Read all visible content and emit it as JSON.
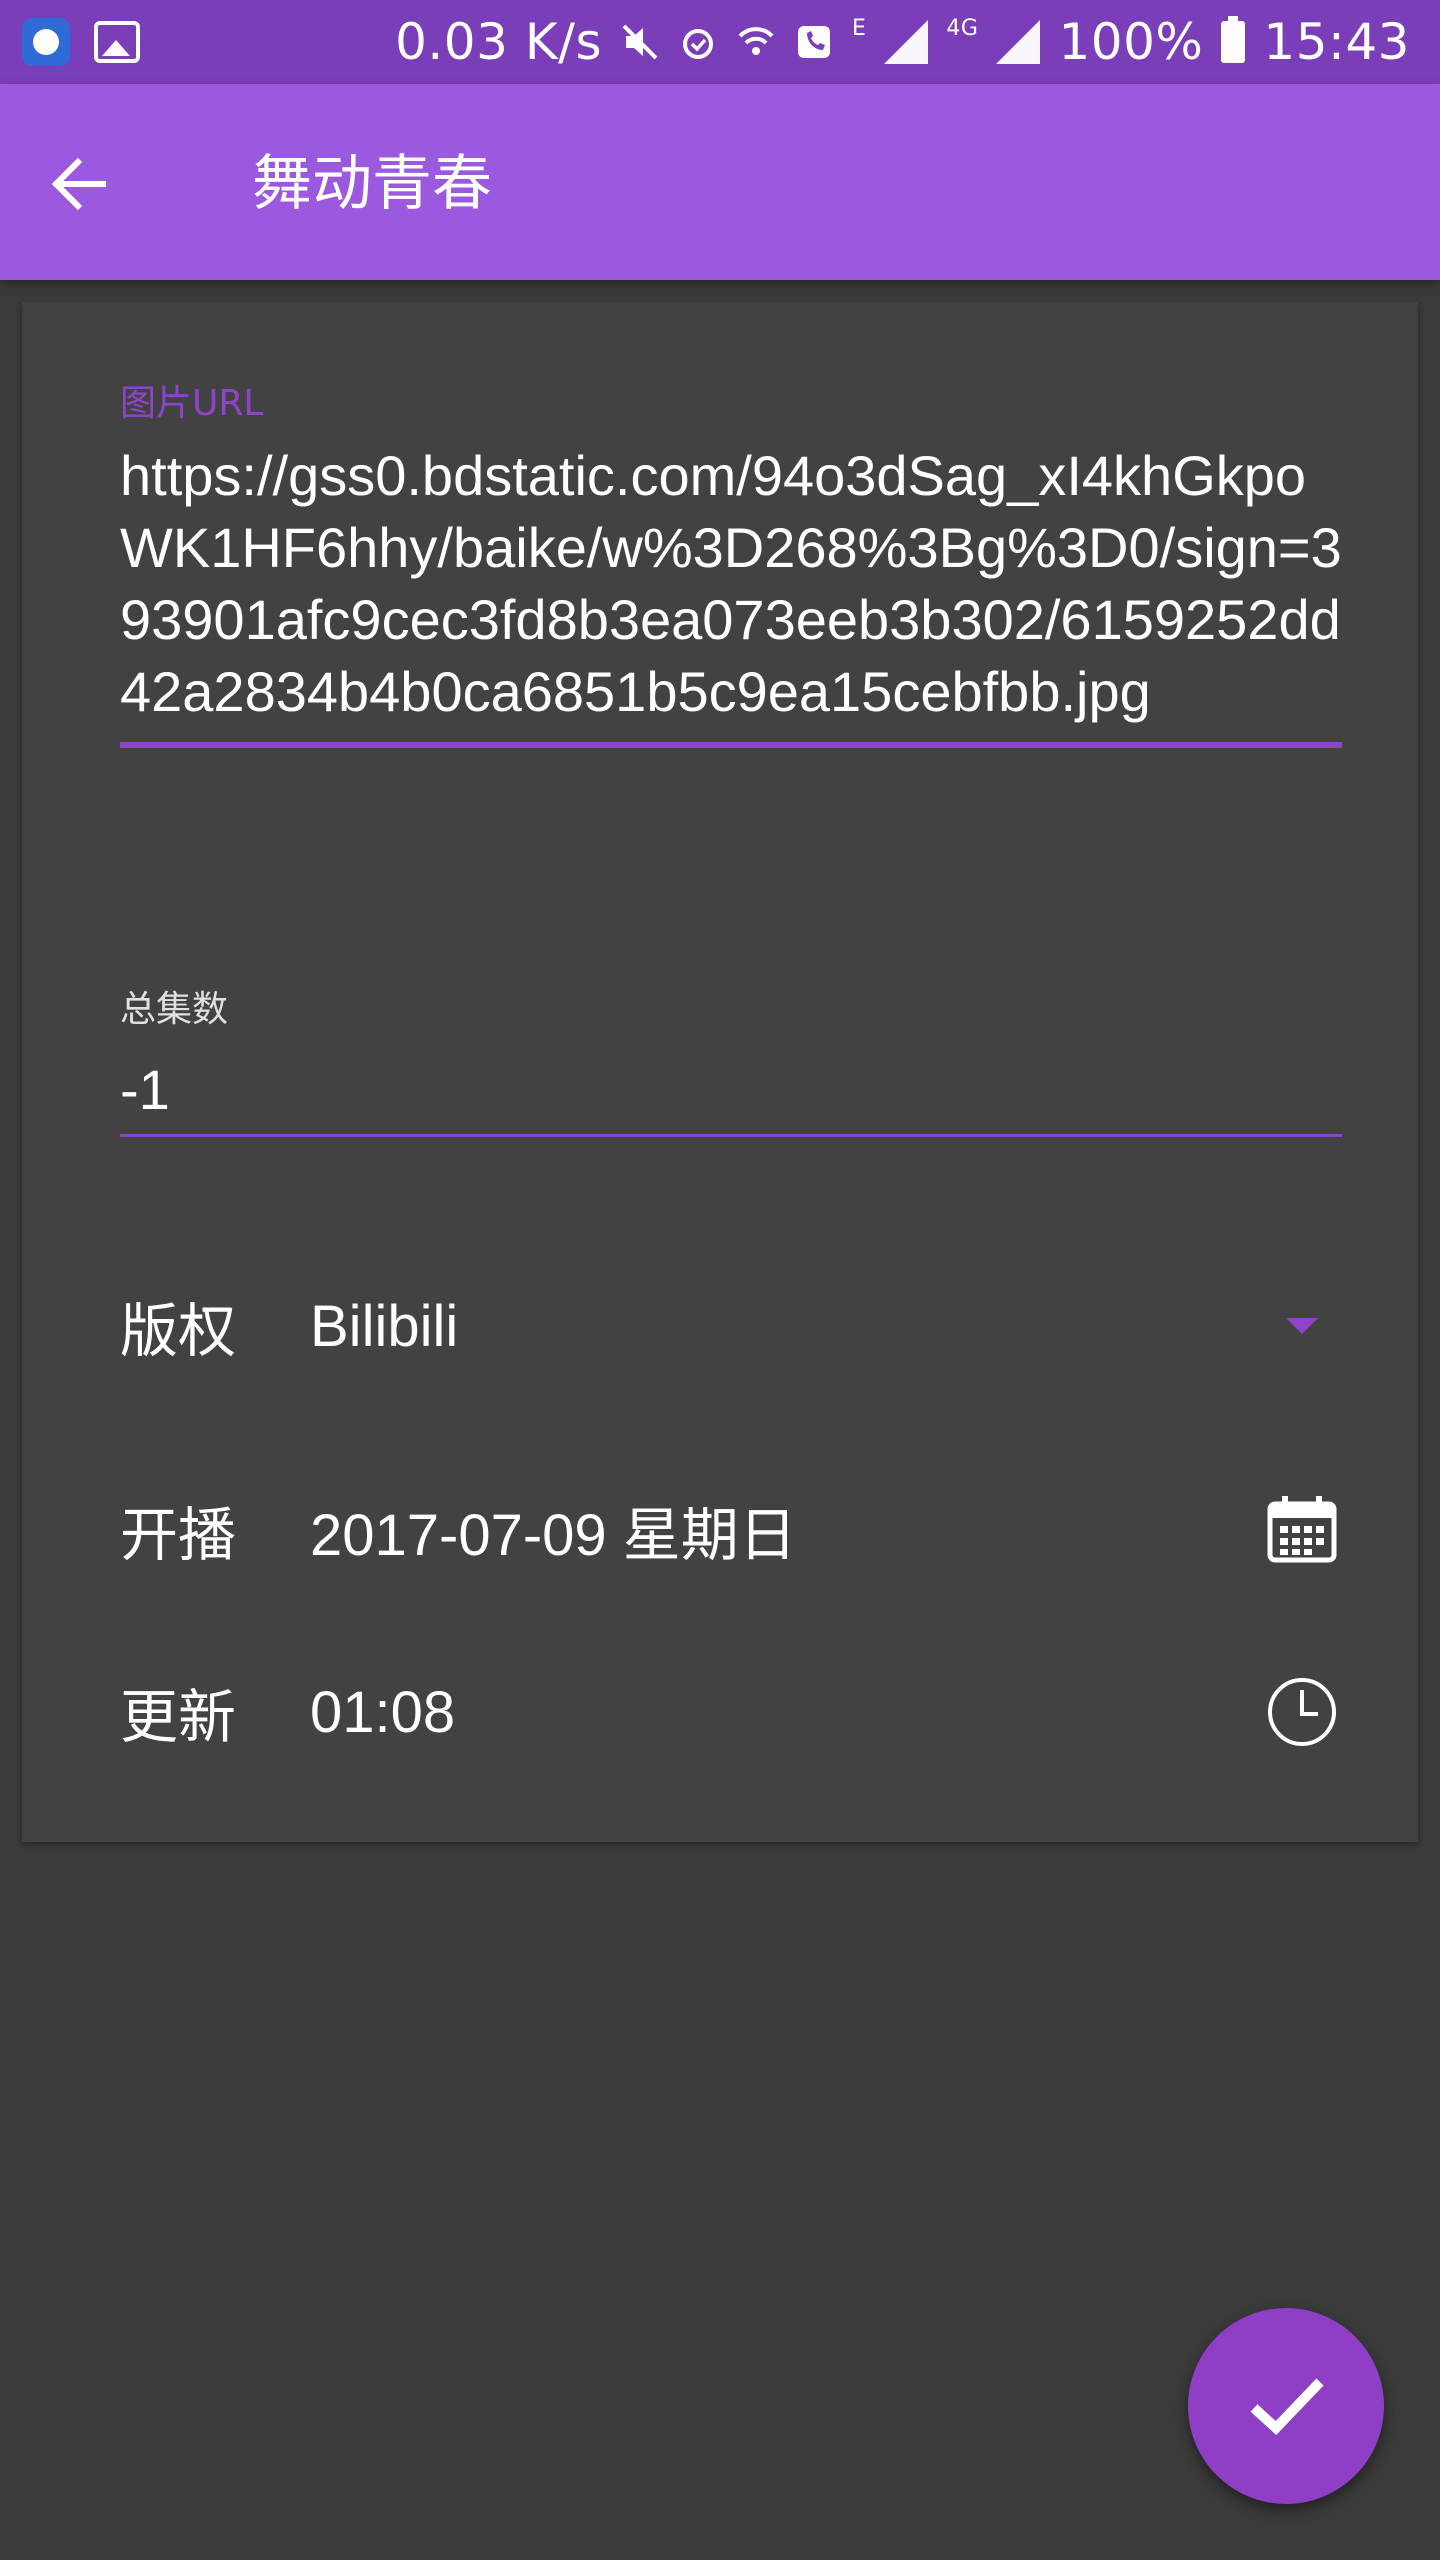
{
  "status_bar": {
    "network_speed": "0.03 K/s",
    "edge_label": "E",
    "lte_label": "4G",
    "battery": "100%",
    "time": "15:43"
  },
  "app_bar": {
    "title": "舞动青春"
  },
  "form": {
    "image_url": {
      "label": "图片URL",
      "value": "https://gss0.bdstatic.com/94o3dSag_xI4khGkpoWK1HF6hhy/baike/w%3D268%3Bg%3D0/sign=393901afc9cec3fd8b3ea073eeb3b302/6159252dd42a2834b4b0ca6851b5c9ea15cebfbb.jpg"
    },
    "total_episodes": {
      "label": "总集数",
      "value": "-1"
    },
    "copyright": {
      "label": "版权",
      "value": "Bilibili"
    },
    "start_date": {
      "label": "开播",
      "value": "2017-07-09 星期日"
    },
    "update_time": {
      "label": "更新",
      "value": "01:08"
    }
  },
  "icons": {
    "back": "arrow-back-icon",
    "dropdown": "triangle-down-icon",
    "calendar": "calendar-icon",
    "clock": "clock-icon",
    "fab": "check-icon"
  },
  "colors": {
    "status_bar": "#7a3fb8",
    "app_bar": "#9b59e0",
    "accent": "#8e44c8",
    "background": "#3b3b3b",
    "card": "#424242"
  }
}
